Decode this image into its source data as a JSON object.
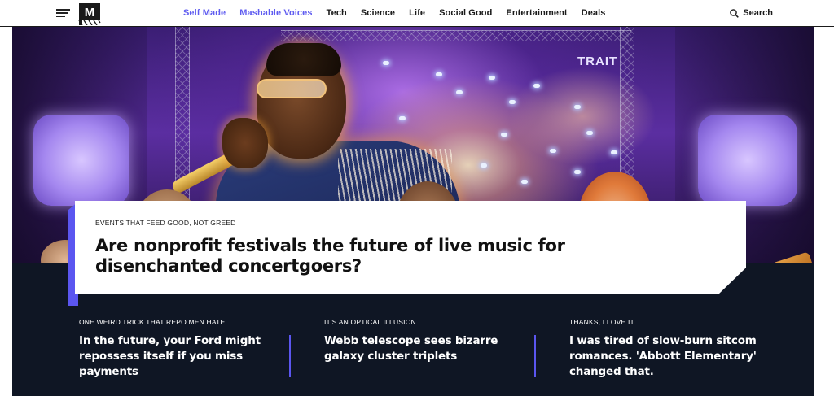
{
  "nav": {
    "links": [
      {
        "label": "Self Made",
        "highlight": true
      },
      {
        "label": "Mashable Voices",
        "highlight": true
      },
      {
        "label": "Tech",
        "highlight": false
      },
      {
        "label": "Science",
        "highlight": false
      },
      {
        "label": "Life",
        "highlight": false
      },
      {
        "label": "Social Good",
        "highlight": false
      },
      {
        "label": "Entertainment",
        "highlight": false
      },
      {
        "label": "Deals",
        "highlight": false
      }
    ],
    "search_label": "Search",
    "accent_color": "#5f5cf0"
  },
  "hero": {
    "stage_sign": "TRAIT",
    "kicker": "EVENTS THAT FEED GOOD, NOT GREED",
    "title": "Are nonprofit festivals the future of live music for disenchanted concertgoers?"
  },
  "stories": [
    {
      "kicker": "ONE WEIRD TRICK THAT REPO MEN HATE",
      "title": "In the future, your Ford might repossess itself if you miss payments"
    },
    {
      "kicker": "IT'S AN OPTICAL ILLUSION",
      "title": "Webb telescope sees bizarre galaxy cluster triplets"
    },
    {
      "kicker": "THANKS, I LOVE IT",
      "title": "I was tired of slow-burn sitcom romances. 'Abbott Elementary' changed that."
    }
  ],
  "colors": {
    "dark_bg": "#0f1624",
    "divider": "#5b56f0"
  }
}
